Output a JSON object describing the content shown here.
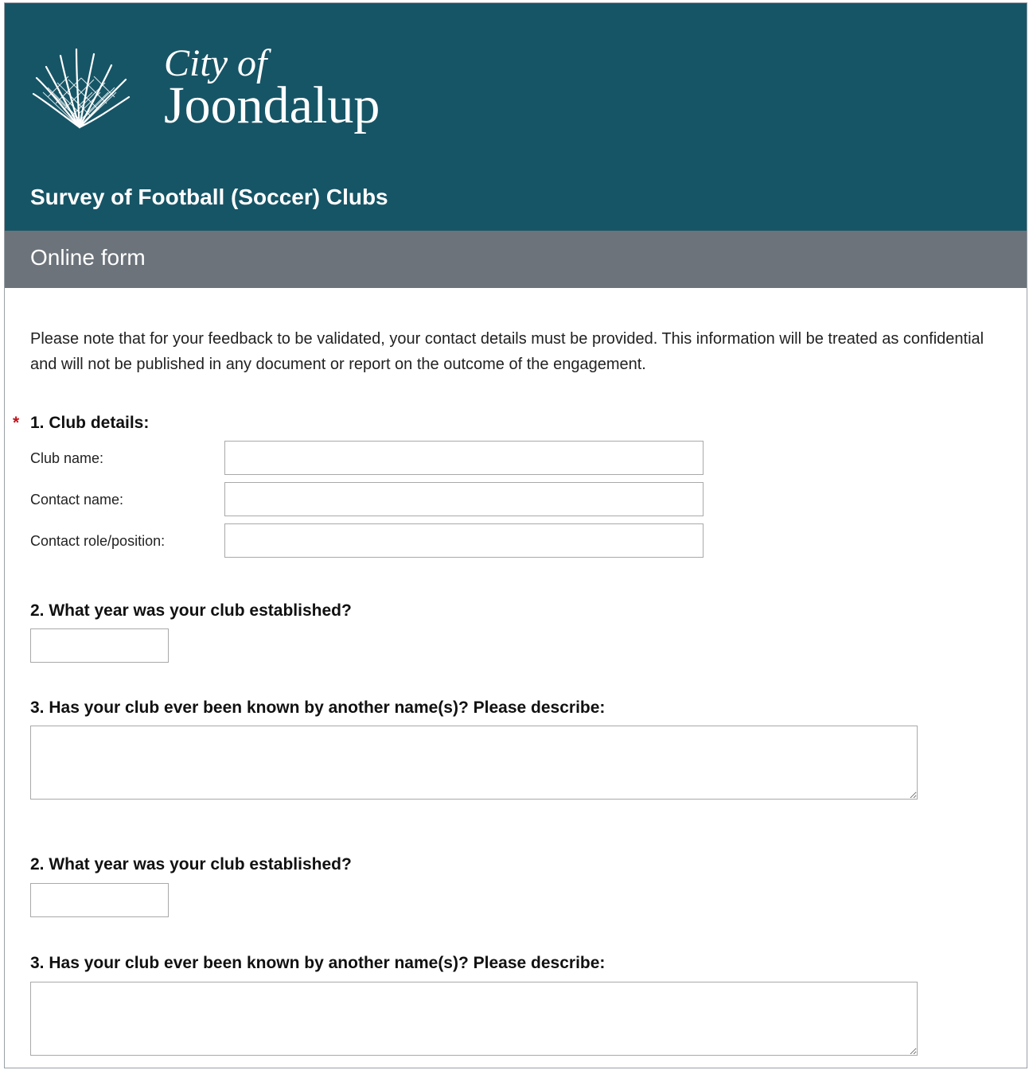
{
  "header": {
    "logo_line1": "City of",
    "logo_line2": "Joondalup",
    "survey_title": "Survey of Football (Soccer) Clubs",
    "brand_color": "#165566"
  },
  "subheader": {
    "title": "Online form",
    "color": "#6c737b"
  },
  "intro": {
    "text": "Please note that for your feedback to be validated, your contact details must be provided. This information will be treated as confidential and will not be published in any document or report on the outcome of the engagement."
  },
  "q1": {
    "required_marker": "*",
    "title": "1. Club details:",
    "fields": [
      {
        "label": "Club name:",
        "value": ""
      },
      {
        "label": "Contact name:",
        "value": ""
      },
      {
        "label": "Contact role/position:",
        "value": ""
      }
    ]
  },
  "q2": {
    "title": "2. What year was your club established?",
    "value": ""
  },
  "q3": {
    "title": "3. Has your club ever been known by another name(s)? Please describe:",
    "value": ""
  },
  "q2b": {
    "title": "2. What year was your club established?",
    "value": ""
  },
  "q3b": {
    "title": "3. Has your club ever been known by another name(s)? Please describe:",
    "value": ""
  },
  "icons": {
    "logo": "city-of-joondalup-logo-icon",
    "resize": "resize-grip-icon"
  }
}
